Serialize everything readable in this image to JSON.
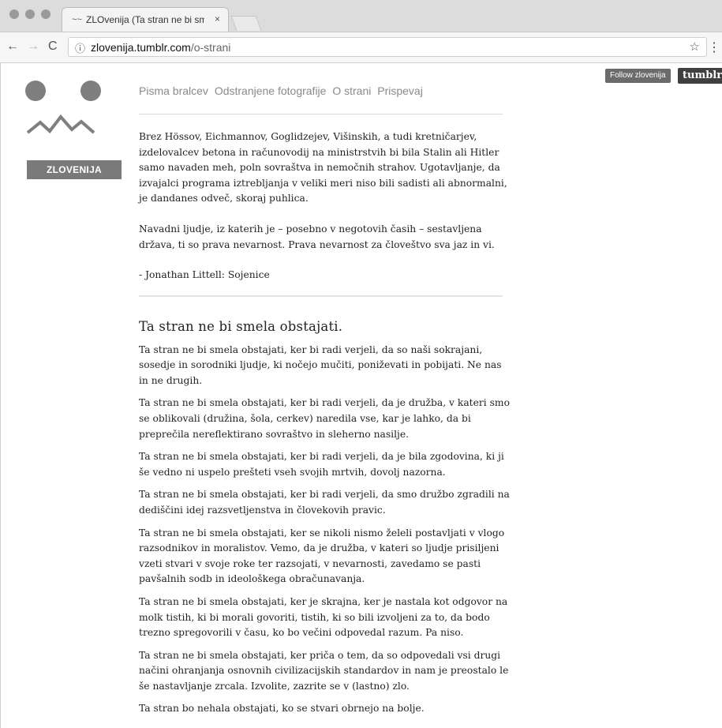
{
  "browser": {
    "tab_title": "ZLOvenija (Ta stran ne bi smela obstajati.)",
    "tab_close": "×",
    "url_host": "zlovenija.tumblr.com",
    "url_path": "/o-strani",
    "back": "←",
    "forward": "→",
    "reload": "C",
    "info": "ⓘ",
    "star": "☆",
    "menu": "⋮"
  },
  "sidebar": {
    "brand": "ZLOVENIJA"
  },
  "top_right": {
    "follow_label": "Follow zlovenija",
    "tumblr_label": "tumblr."
  },
  "nav": {
    "items": [
      "Pisma bralcev",
      "Odstranjene fotografije",
      "O strani",
      "Prispevaj"
    ]
  },
  "quote": {
    "paragraphs": [
      "Brez Hössov, Eichmannov, Goglidzejev, Višinskih, a tudi kretničarjev, izdelovalcev betona in računovodij na ministrstvih bi bila Stalin ali Hitler samo navaden meh, poln sovraštva in nemočnih strahov. Ugotavljanje, da izvajalci programa iztrebljanja v veliki meri niso bili sadisti ali abnormalni, je dandanes odveč, skoraj puhlica.",
      "Navadni ljudje, iz katerih je – posebno v negotovih časih – sestavljena država, ti so prava nevarnost. Prava nevarnost za človeštvo sva jaz in vi.",
      "- Jonathan Littell: Sojenice"
    ]
  },
  "article": {
    "title": "Ta stran ne bi smela obstajati.",
    "paragraphs": [
      "Ta stran ne bi smela obstajati, ker bi radi verjeli, da so naši sokrajani, sosedje in sorodniki ljudje, ki nočejo mučiti, poniževati in pobijati. Ne nas in ne drugih.",
      "Ta stran ne bi smela obstajati, ker bi radi verjeli, da je družba, v kateri smo se oblikovali (družina, šola, cerkev) naredila vse, kar je lahko, da bi preprečila nereflektirano sovraštvo in sleherno nasilje.",
      "Ta stran ne bi smela obstajati, ker bi radi verjeli, da je bila zgodovina, ki ji še vedno ni uspelo prešteti vseh svojih mrtvih, dovolj nazorna.",
      "Ta stran ne bi smela obstajati, ker bi radi verjeli, da smo družbo zgradili na dediščini idej razsvetljenstva in človekovih pravic.",
      "Ta stran ne bi smela obstajati, ker se nikoli nismo želeli postavljati v vlogo razsodnikov in moralistov. Vemo, da je družba, v kateri so ljudje prisiljeni vzeti stvari v svoje roke ter razsojati, v nevarnosti, zavedamo se pasti pavšalnih sodb in ideološkega obračunavanja.",
      "Ta stran ne bi smela obstajati, ker je skrajna, ker je nastala kot odgovor na molk tistih, ki bi morali govoriti, tistih, ki so bili izvoljeni za to, da bodo trezno spregovorili v času, ko bo večini odpovedal razum. Pa niso.",
      "Ta stran ne bi smela obstajati, ker priča o tem, da so odpovedali vsi drugi načini ohranjanja osnovnih civilizacijskih standardov in nam je preostalo le še nastavljanje zrcala. Izvolite, zazrite se v (lastno) zlo.",
      "Ta stran bo nehala obstajati, ko se stvari obrnejo na bolje."
    ]
  }
}
